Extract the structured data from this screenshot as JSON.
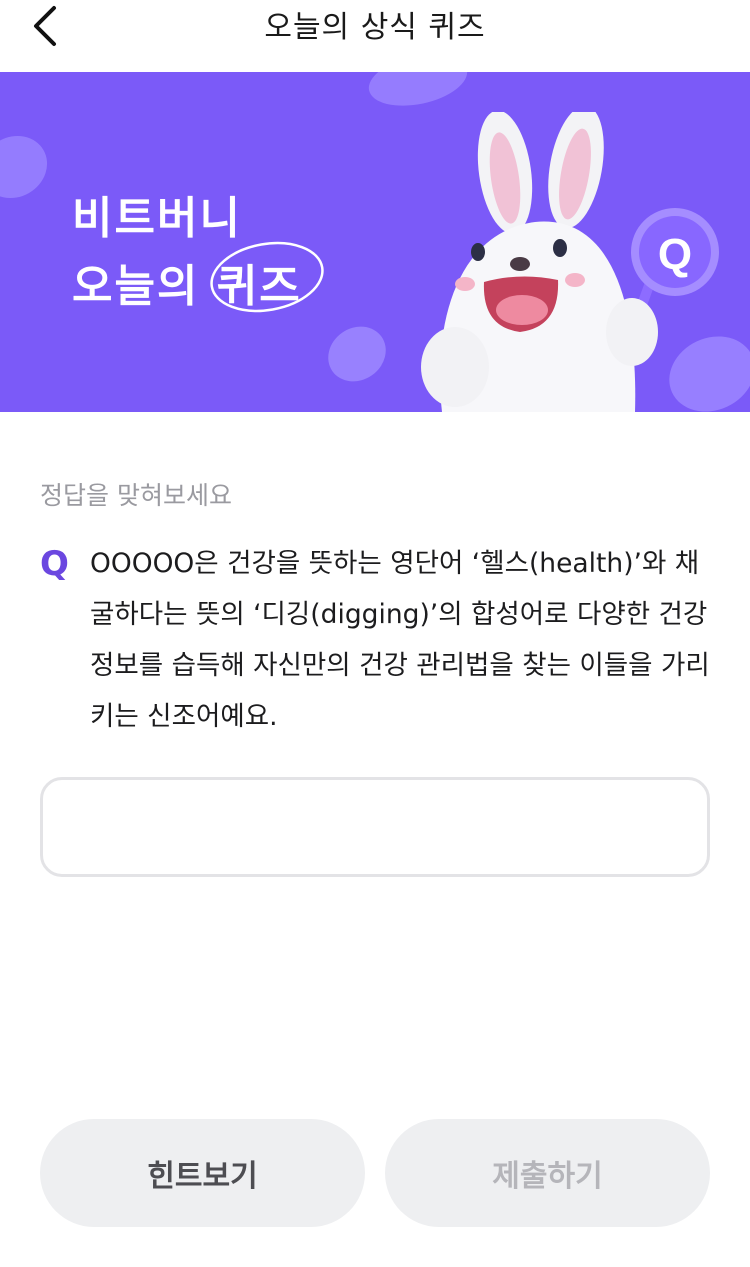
{
  "header": {
    "title": "오늘의 상식 퀴즈"
  },
  "banner": {
    "line1": "비트버니",
    "line2_prefix": "오늘의 ",
    "line2_quiz": "퀴즈",
    "badge_letter": "Q"
  },
  "quiz": {
    "prompt": "정답을 맞혀보세요",
    "q_mark": "Q",
    "question": "OOOOO은 건강을 뜻하는 영단어 ‘헬스(health)’와 채굴하다는 뜻의 ‘디깅(digging)’의 합성어로 다양한 건강 정보를 습득해 자신만의 건강 관리법을 찾는 이들을 가리키는 신조어예요.",
    "answer_value": ""
  },
  "buttons": {
    "hint": "힌트보기",
    "submit": "제출하기"
  },
  "colors": {
    "accent": "#7b5af8",
    "q_mark": "#6b47e0"
  }
}
